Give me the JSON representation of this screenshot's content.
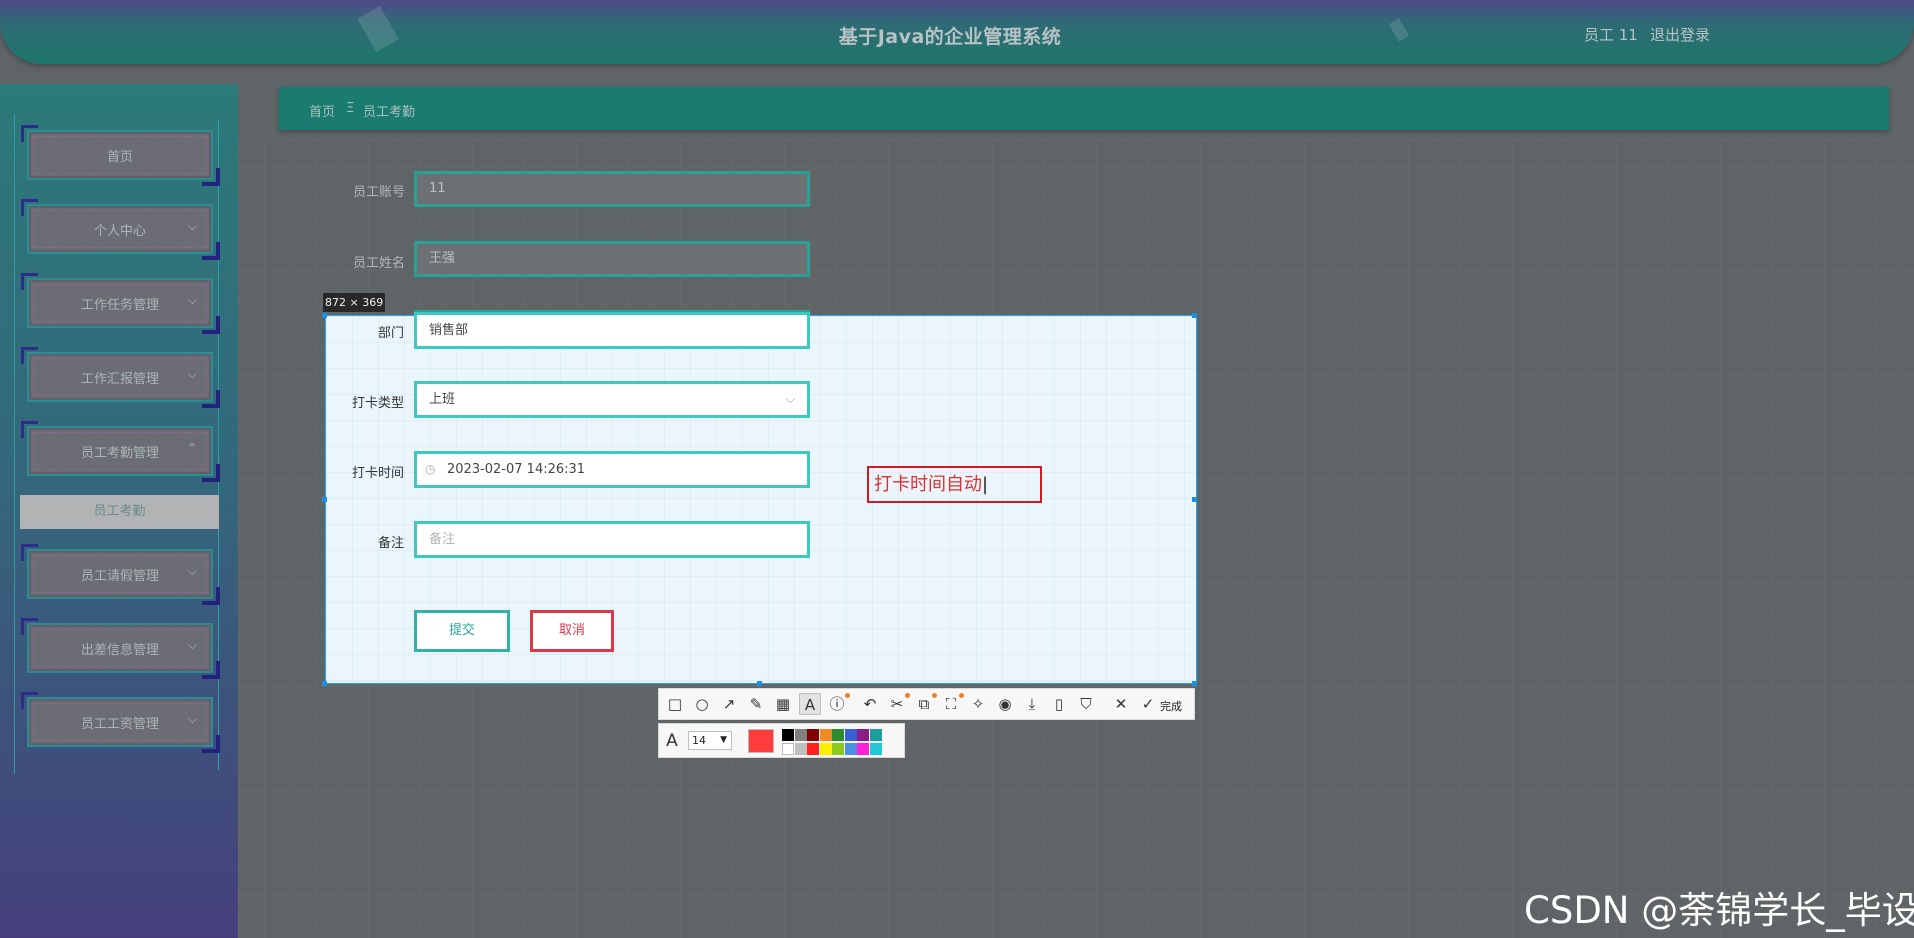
{
  "header": {
    "title": "基于Java的企业管理系统",
    "user_label": "员工 11",
    "logout_label": "退出登录"
  },
  "sidebar": {
    "items": [
      {
        "label": "首页",
        "chevron": ""
      },
      {
        "label": "个人中心",
        "chevron": "⌵"
      },
      {
        "label": "工作任务管理",
        "chevron": "⌵"
      },
      {
        "label": "工作汇报管理",
        "chevron": "⌵"
      },
      {
        "label": "员工考勤管理",
        "chevron": "⌃"
      },
      {
        "label": "员工请假管理",
        "chevron": "⌵"
      },
      {
        "label": "出差信息管理",
        "chevron": "⌵"
      },
      {
        "label": "员工工资管理",
        "chevron": "⌵"
      }
    ],
    "submenu_active": "员工考勤"
  },
  "breadcrumb": {
    "home": "首页",
    "separator": "Ξ",
    "current": "员工考勤"
  },
  "form": {
    "account_label": "员工账号",
    "account_value": "11",
    "name_label": "员工姓名",
    "name_value": "王强",
    "dept_label": "部门",
    "dept_value": "销售部",
    "type_label": "打卡类型",
    "type_value": "上班",
    "time_label": "打卡时间",
    "time_value": "2023-02-07 14:26:31",
    "note_label": "备注",
    "note_placeholder": "备注",
    "submit_label": "提交",
    "cancel_label": "取消"
  },
  "capture": {
    "size_label": "872 × 369",
    "annotation_text": "打卡时间自动",
    "done_label": "完成",
    "font_size": "14",
    "current_color": "#ff3b3b",
    "palette_top": [
      "#000000",
      "#808080",
      "#800000",
      "#f08a24",
      "#2e8b2e",
      "#3560d8",
      "#8b1a8b",
      "#1a9ea0"
    ],
    "palette_bottom": [
      "#ffffff",
      "#c0c0c0",
      "#ff2020",
      "#ffee00",
      "#8cc81e",
      "#4a90e2",
      "#ff20d8",
      "#20c8d8"
    ]
  },
  "watermark": "CSDN @荼锦学长_毕设"
}
